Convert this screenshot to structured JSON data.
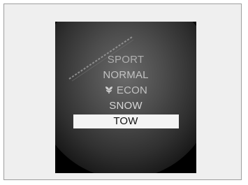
{
  "display": {
    "modes": [
      {
        "label": "SPORT",
        "icon": null,
        "selected": false
      },
      {
        "label": "NORMAL",
        "icon": null,
        "selected": false
      },
      {
        "label": "ECON",
        "icon": "econ-leaf-icon",
        "selected": false
      },
      {
        "label": "SNOW",
        "icon": null,
        "selected": false
      },
      {
        "label": "TOW",
        "icon": null,
        "selected": true
      }
    ]
  },
  "colors": {
    "background": "#000000",
    "text": "#c2c2c2",
    "highlight_bg": "#f4f4f4",
    "highlight_text": "#111111"
  }
}
